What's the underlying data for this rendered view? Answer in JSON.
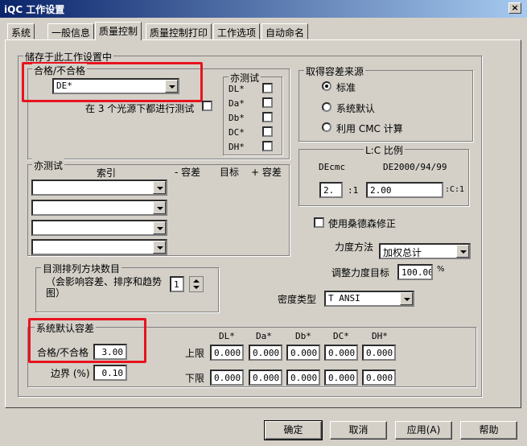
{
  "window": {
    "title": "iQC 工作设置",
    "close": "×"
  },
  "tabs": [
    "系统",
    "一般信息",
    "质量控制",
    "质量控制打印",
    "工作选项",
    "自动命名"
  ],
  "main_group": {
    "legend": "储存于此工作设置中"
  },
  "pass_fail": {
    "legend": "合格/不合格",
    "combo_value": "DE*",
    "three_light_label": "在 3 个光源下都进行测试"
  },
  "sub_tests": {
    "legend": "亦测试",
    "items": [
      "DL*",
      "Da*",
      "Db*",
      "DC*",
      "DH*"
    ]
  },
  "tolerance_source": {
    "legend": "取得容差来源",
    "options": [
      "标准",
      "系统默认",
      "利用 CMC 计算"
    ]
  },
  "lc_ratio": {
    "legend": "L:C 比例",
    "decmc": "DEcmc",
    "de2000": "DE2000/94/99",
    "l_value": "2.",
    "sep": ":1",
    "c_value": "2.00",
    "suffix": ":C:1"
  },
  "also_test": {
    "legend": "亦测试",
    "col_index": "索引",
    "col_minus": "- 容差",
    "col_target": "目标",
    "col_plus": "+ 容差"
  },
  "sanders": {
    "label": "使用桑德森修正"
  },
  "strength_method": {
    "label": "力度方法",
    "value": "加权总计"
  },
  "strength_target": {
    "label": "调整力度目标",
    "value": "100.00",
    "unit": "%"
  },
  "density": {
    "label": "密度类型",
    "value": "T ANSI"
  },
  "visual": {
    "legend": "目测排列方块数目",
    "note": "（会影响容差、排序和趋势图）",
    "value": "1"
  },
  "system_tol": {
    "legend": "系统默认容差",
    "pass_label": "合格/不合格",
    "pass_value": "3.00",
    "border_label": "边界 (%)",
    "border_value": "0.10",
    "headers": [
      "DL*",
      "Da*",
      "Db*",
      "DC*",
      "DH*"
    ],
    "upper_label": "上限",
    "lower_label": "下限",
    "upper": [
      "0.000",
      "0.000",
      "0.000",
      "0.000",
      "0.000"
    ],
    "lower": [
      "0.000",
      "0.000",
      "0.000",
      "0.000",
      "0.000"
    ]
  },
  "buttons": {
    "ok": "确定",
    "cancel": "取消",
    "apply": "应用(A)",
    "help": "帮助"
  }
}
